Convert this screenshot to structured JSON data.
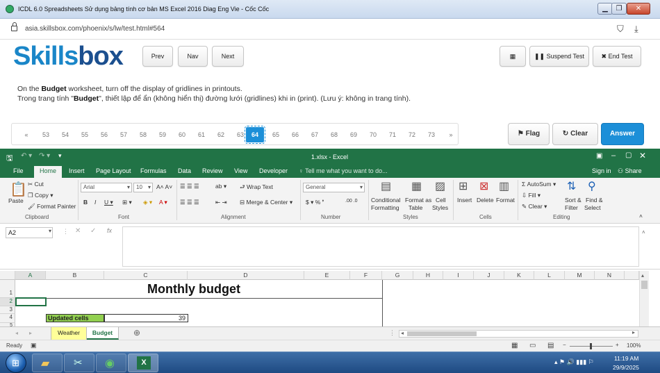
{
  "browser": {
    "title": "ICDL 6.0 Spreadsheets Sử dụng bảng tính cơ bản MS Excel 2016 Diag Eng Vie - Cốc Cốc",
    "url": "asia.skillsbox.com/phoenix/s/lw/test.html#564"
  },
  "skills": {
    "logo_part1": "Skills",
    "logo_part2": "box",
    "prev": "Prev",
    "nav": "Nav",
    "next": "Next",
    "suspend": "Suspend Test",
    "end": "End Test",
    "flag": "Flag",
    "clear": "Clear",
    "answer": "Answer",
    "question_en_pre": "On the ",
    "question_en_bold": "Budget",
    "question_en_post": " worksheet, turn off the display of gridlines in printouts.",
    "question_vi_pre": "Trong trang tính \"",
    "question_vi_bold": "Budget",
    "question_vi_post": "\", thiết lập để ẩn (không hiển thị) đường lưới (gridlines) khi in (print). (Lưu ý: không in trang tính).",
    "pages": [
      "«",
      "53",
      "54",
      "55",
      "56",
      "57",
      "58",
      "59",
      "60",
      "61",
      "62",
      "63",
      "64",
      "65",
      "66",
      "67",
      "68",
      "69",
      "70",
      "71",
      "72",
      "73",
      "»"
    ],
    "current_page": "64"
  },
  "excel": {
    "title": "1.xlsx - Excel",
    "tabs": [
      "File",
      "Home",
      "Insert",
      "Page Layout",
      "Formulas",
      "Data",
      "Review",
      "View",
      "Developer"
    ],
    "tellme": "Tell me what you want to do...",
    "signin": "Sign in",
    "share": "Share",
    "ribbon": {
      "paste": "Paste",
      "cut": "Cut",
      "copy": "Copy",
      "format_painter": "Format Painter",
      "clipboard": "Clipboard",
      "font_name": "Arial",
      "font_size": "10",
      "font": "Font",
      "wrap": "Wrap Text",
      "merge": "Merge & Center",
      "alignment": "Alignment",
      "numfmt": "General",
      "number": "Number",
      "cond1": "Conditional",
      "cond2": "Formatting",
      "fmt1": "Format as",
      "fmt2": "Table",
      "cell1": "Cell",
      "cell2": "Styles",
      "styles": "Styles",
      "insert": "Insert",
      "delete": "Delete",
      "format": "Format",
      "cells": "Cells",
      "autosum": "AutoSum",
      "fill": "Fill",
      "clear": "Clear",
      "sort1": "Sort &",
      "sort2": "Filter",
      "find1": "Find &",
      "find2": "Select",
      "editing": "Editing"
    },
    "namebox": "A2",
    "columns": [
      "A",
      "B",
      "C",
      "D",
      "E",
      "F",
      "G",
      "H",
      "I",
      "J",
      "K",
      "L",
      "M",
      "N"
    ],
    "rows": [
      "1",
      "2",
      "3",
      "4",
      "5"
    ],
    "cell_title": "Monthly budget",
    "cell_label": "Updated cells",
    "cell_value": "39",
    "sheets": [
      "Weather",
      "Budget"
    ],
    "status_ready": "Ready",
    "zoom": "100%"
  },
  "taskbar": {
    "time": "11:19 AM",
    "date": "29/9/2025"
  },
  "colors": {
    "excel_green": "#217346",
    "skills_blue": "#1c8fd8"
  }
}
